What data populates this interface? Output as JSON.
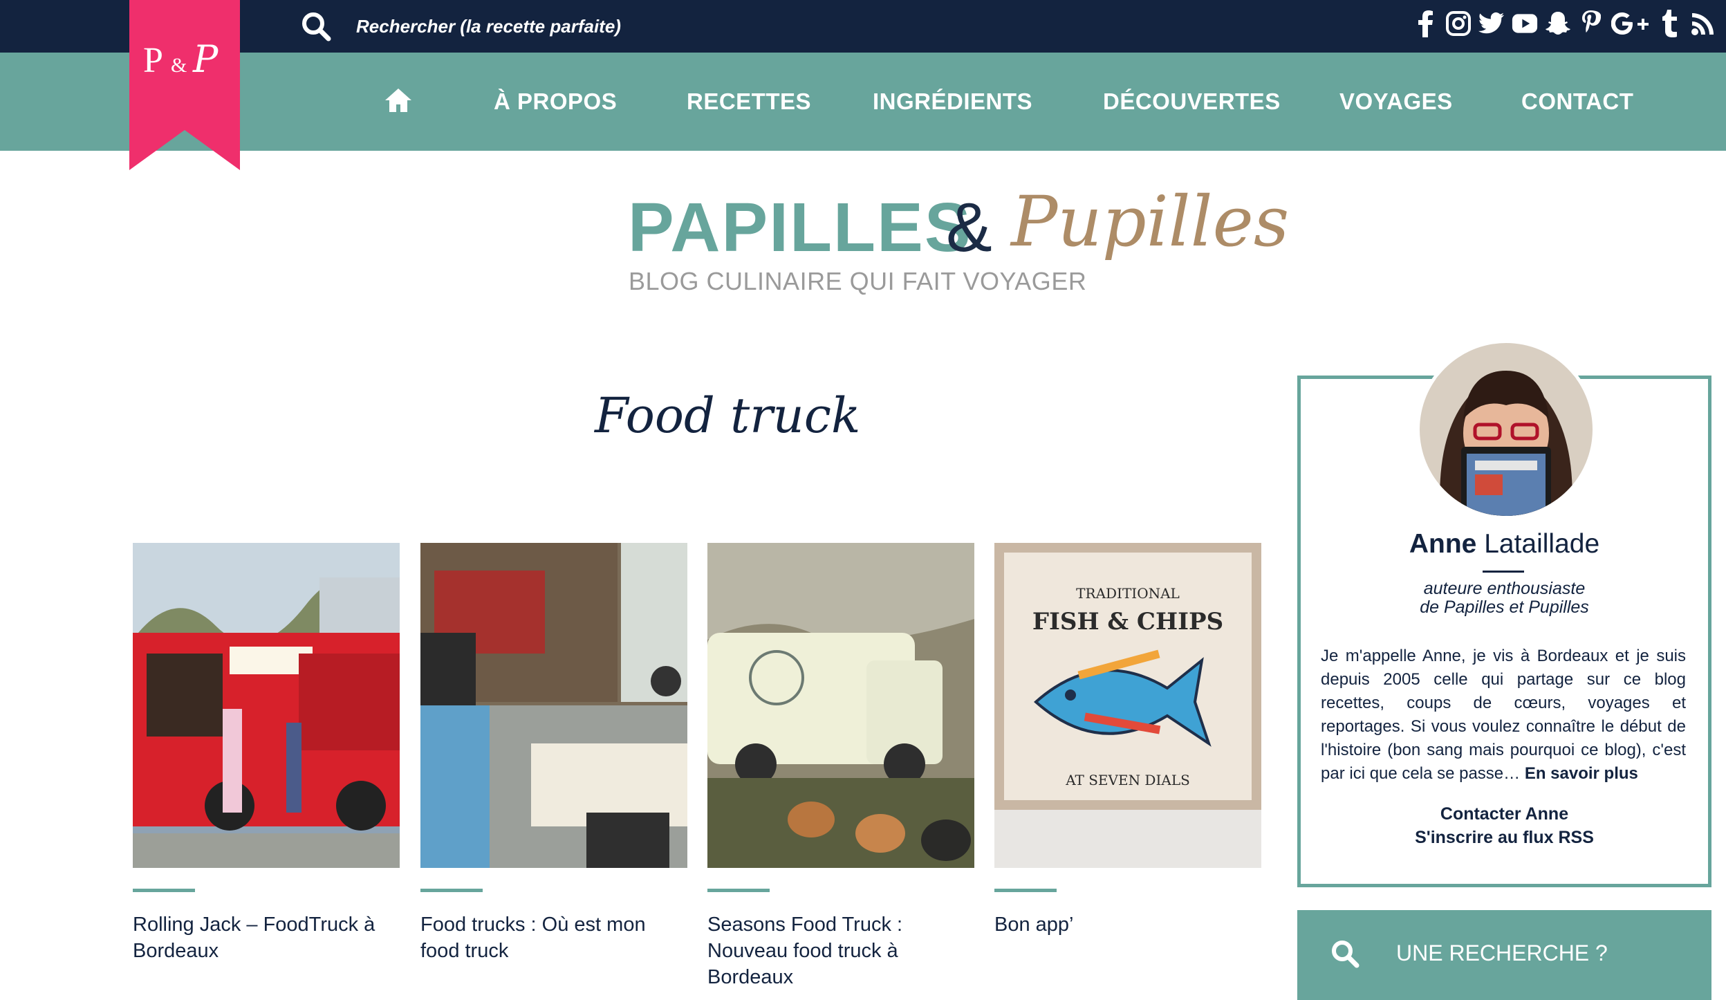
{
  "topbar": {
    "search_placeholder": "Rechercher (la recette parfaite)",
    "social_icons": [
      "facebook-icon",
      "instagram-icon",
      "twitter-icon",
      "youtube-icon",
      "snapchat-icon",
      "pinterest-icon",
      "google-plus-icon",
      "tumblr-icon",
      "rss-icon"
    ]
  },
  "nav": {
    "home_icon": "home-icon",
    "items": [
      {
        "label": "À PROPOS"
      },
      {
        "label": "RECETTES"
      },
      {
        "label": "INGRÉDIENTS"
      },
      {
        "label": "DÉCOUVERTES"
      },
      {
        "label": "VOYAGES"
      },
      {
        "label": "CONTACT"
      }
    ]
  },
  "ribbon": {
    "monogram": "P&P",
    "color": "#ef2f6c"
  },
  "logo": {
    "word1": "PAPILLES",
    "amp": "&",
    "word2": "Pupilles",
    "tagline": "BLOG CULINAIRE QUI FAIT VOYAGER"
  },
  "category": {
    "title": "Food truck"
  },
  "posts": [
    {
      "title": "Rolling Jack – FoodTruck à Bordeaux"
    },
    {
      "title": "Food trucks : Où est mon food truck"
    },
    {
      "title": "Seasons Food Truck : Nouveau food truck à Bordeaux"
    },
    {
      "title": "Bon app’"
    }
  ],
  "sidebar": {
    "author_first": "Anne",
    "author_last": "Lataillade",
    "subtitle_line1": "auteure enthousiaste",
    "subtitle_line2": "de Papilles et Pupilles",
    "bio": "Je m'appelle Anne, je vis à Bordeaux et je suis depuis 2005 celle qui partage sur ce blog recettes, coups de cœurs, voyages et reportages. Si vous voulez connaître le début de l'histoire (bon sang mais pourquoi ce blog), c'est par ici que cela se passe…",
    "more": "En savoir plus",
    "contact": "Contacter Anne",
    "rss": "S'inscrire au flux RSS",
    "search_label": "UNE RECHERCHE ?"
  },
  "colors": {
    "dark_navy": "#13233f",
    "teal": "#68a59c",
    "pink": "#ef2f6c",
    "gold": "#ad8c67"
  }
}
